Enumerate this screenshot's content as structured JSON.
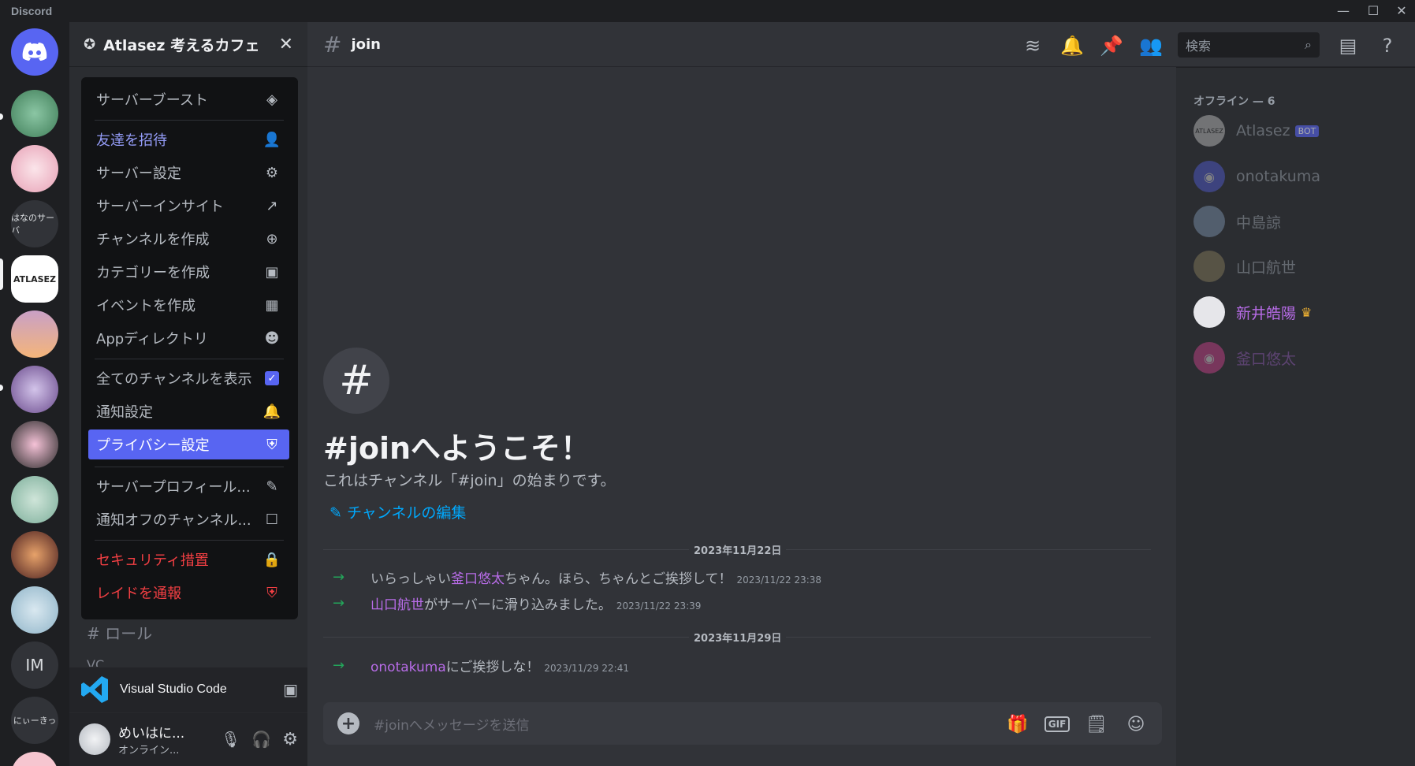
{
  "app": {
    "brand": "Discord"
  },
  "guild": {
    "name": "Atlasez 考えるカフェ",
    "close": "✕"
  },
  "menu": {
    "items": [
      {
        "label": "サーバーブースト",
        "icon": "boost-icon"
      },
      {
        "label": "友達を招待",
        "icon": "invite-icon"
      },
      {
        "label": "サーバー設定",
        "icon": "gear-icon"
      },
      {
        "label": "サーバーインサイト",
        "icon": "insights-icon"
      },
      {
        "label": "チャンネルを作成",
        "icon": "plus-circle-icon"
      },
      {
        "label": "カテゴリーを作成",
        "icon": "folder-plus-icon"
      },
      {
        "label": "イベントを作成",
        "icon": "calendar-plus-icon"
      },
      {
        "label": "Appディレクトリ",
        "icon": "robot-icon"
      },
      {
        "label": "全てのチャンネルを表示",
        "icon": "checkbox-checked-icon"
      },
      {
        "label": "通知設定",
        "icon": "bell-icon"
      },
      {
        "label": "プライバシー設定",
        "icon": "shield-icon"
      },
      {
        "label": "サーバープロフィール...",
        "icon": "pencil-icon"
      },
      {
        "label": "通知オフのチャンネル...",
        "icon": "checkbox-empty-icon"
      },
      {
        "label": "セキュリティ措置",
        "icon": "lock-icon"
      },
      {
        "label": "レイドを通報",
        "icon": "shield-alert-icon"
      }
    ]
  },
  "sidebar": {
    "channel_roles": "# ロール",
    "channel_vc": "VC",
    "activity": {
      "title": "Visual Studio Code"
    },
    "user": {
      "name": "めいはに...",
      "status": "オンライン..."
    }
  },
  "servers": {
    "labels": [
      "はなのサーバ",
      "IM",
      "にぃーきっ"
    ]
  },
  "channel": {
    "name": "join",
    "welcome_title": "#joinへようこそ！",
    "welcome_sub": "これはチャンネル「#join」の始まりです。",
    "edit_link": "チャンネルの編集"
  },
  "search": {
    "placeholder": "検索"
  },
  "messages": {
    "date1": "2023年11月22日",
    "date2": "2023年11月29日",
    "m1": {
      "pre": "いらっしゃい",
      "name": "釜口悠太",
      "post": "ちゃん。ほら、ちゃんとご挨拶して！",
      "ts": "2023/11/22 23:38"
    },
    "m2": {
      "name": "山口航世",
      "post": "がサーバーに滑り込みました。",
      "ts": "2023/11/22 23:39"
    },
    "m3": {
      "name": "onotakuma",
      "post": "にご挨拶しな！",
      "ts": "2023/11/29 22:41"
    }
  },
  "composer": {
    "placeholder": "#joinへメッセージを送信",
    "gif": "GIF"
  },
  "members": {
    "section": "オフライン — 6",
    "list": [
      {
        "name": "Atlasez",
        "badge": "BOT"
      },
      {
        "name": "onotakuma"
      },
      {
        "name": "中島諒"
      },
      {
        "name": "山口航世"
      },
      {
        "name": "新井皓陽"
      },
      {
        "name": "釜口悠太"
      }
    ]
  },
  "colors": {
    "accent": "#5865f2",
    "danger": "#f23f43",
    "link": "#00a8fc",
    "owner": "#b86ce8"
  }
}
